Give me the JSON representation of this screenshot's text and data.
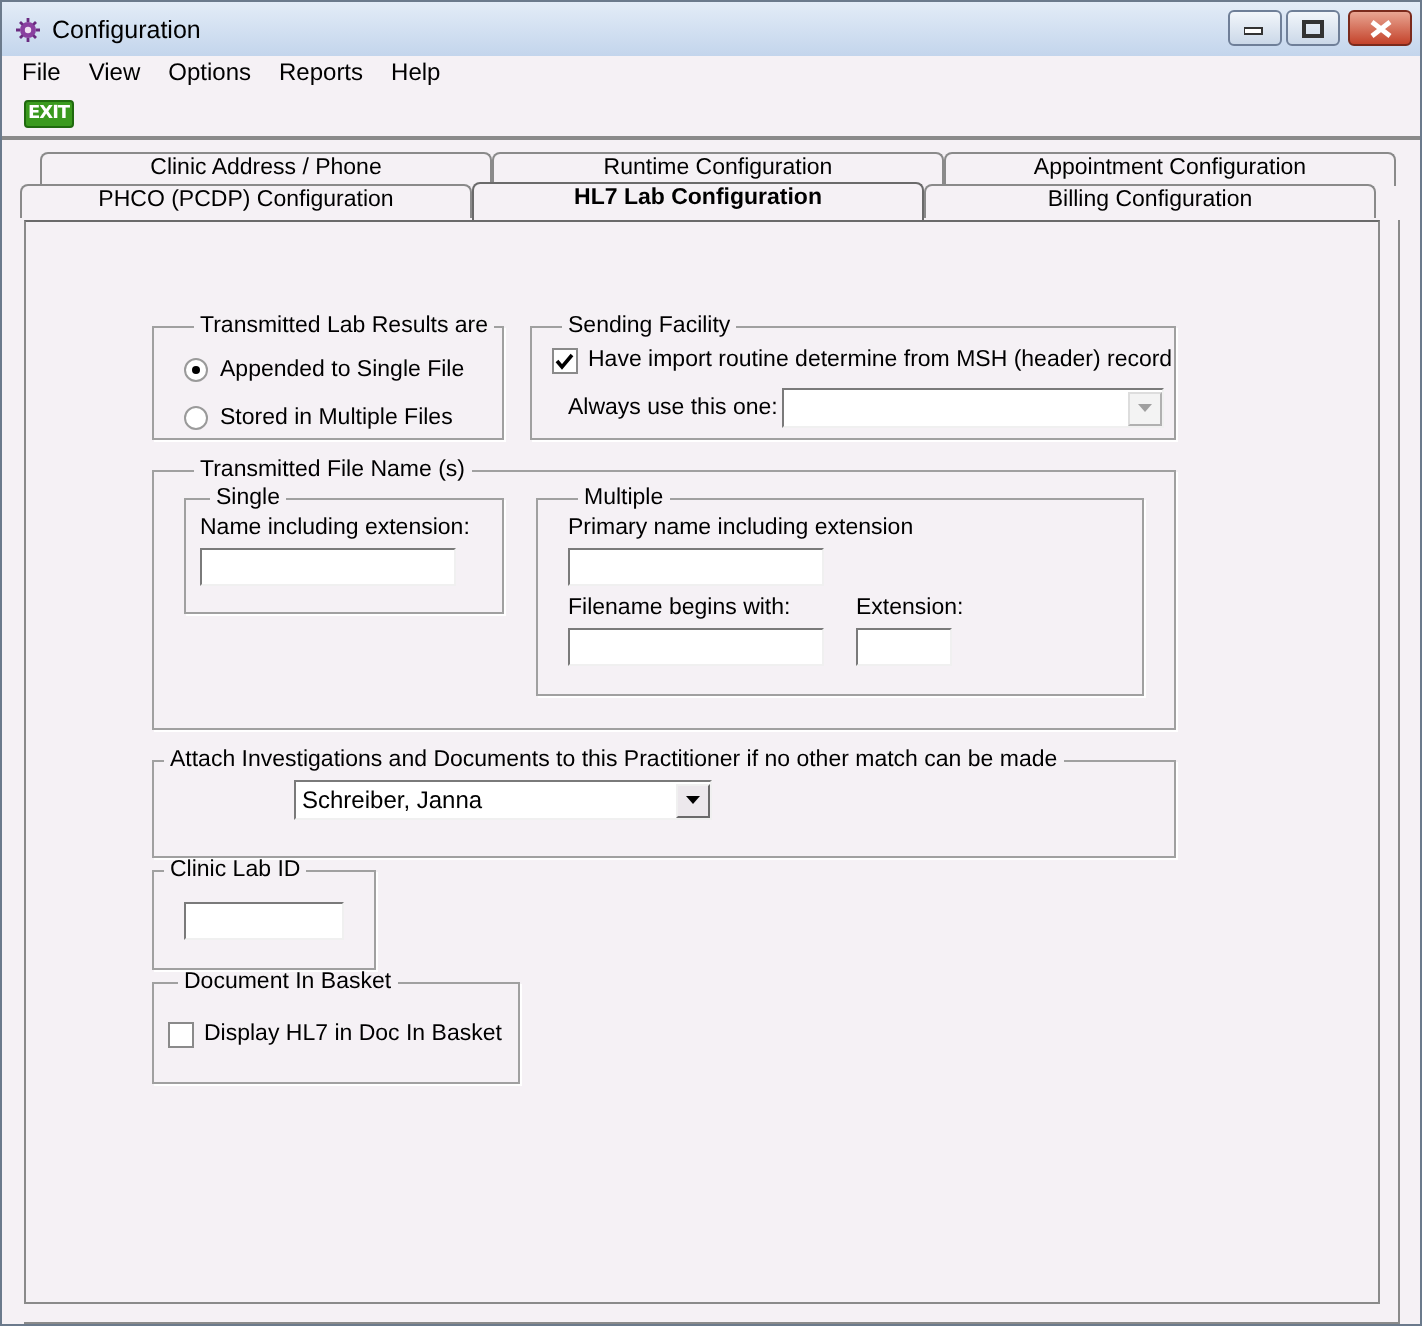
{
  "window": {
    "title": "Configuration"
  },
  "menu": [
    "File",
    "View",
    "Options",
    "Reports",
    "Help"
  ],
  "toolbar": [
    {
      "kind": "exit",
      "label": "EXIT"
    }
  ],
  "tab_rows": [
    [
      {
        "label": "Clinic Address / Phone",
        "selected": false
      },
      {
        "label": "Runtime Configuration",
        "selected": false
      },
      {
        "label": "Appointment Configuration",
        "selected": false
      }
    ],
    [
      {
        "label": "PHCO (PCDP) Configuration",
        "selected": false
      },
      {
        "label": "HL7 Lab Configuration",
        "selected": true
      },
      {
        "label": "Billing Configuration",
        "selected": false
      }
    ]
  ],
  "lab_results": {
    "legend": "Transmitted Lab Results are",
    "options": [
      {
        "label": "Appended to Single File",
        "selected": true
      },
      {
        "label": "Stored in Multiple Files",
        "selected": false
      }
    ]
  },
  "sending_facility": {
    "legend": "Sending Facility",
    "checkbox": {
      "label": "Have import routine determine from MSH (header) record",
      "checked": true
    },
    "always_label": "Always use this one:",
    "dropdown": {
      "disabled": true
    }
  },
  "file_names": {
    "legend": "Transmitted File Name (s)",
    "single": {
      "legend": "Single",
      "name_label": "Name including extension:"
    },
    "multiple": {
      "legend": "Multiple",
      "primary_label": "Primary name including extension",
      "begins_label": "Filename begins with:",
      "extension_label": "Extension:"
    }
  },
  "practitioner": {
    "legend": "Attach Investigations and Documents to this Practitioner if no other match can be made",
    "dropdown": {
      "value": "Schreiber, Janna",
      "disabled": false
    }
  },
  "clinic_lab_id": {
    "legend": "Clinic Lab ID"
  },
  "doc_basket": {
    "legend": "Document In Basket",
    "checkbox": {
      "label": "Display HL7 in Doc In Basket",
      "checked": false
    }
  }
}
